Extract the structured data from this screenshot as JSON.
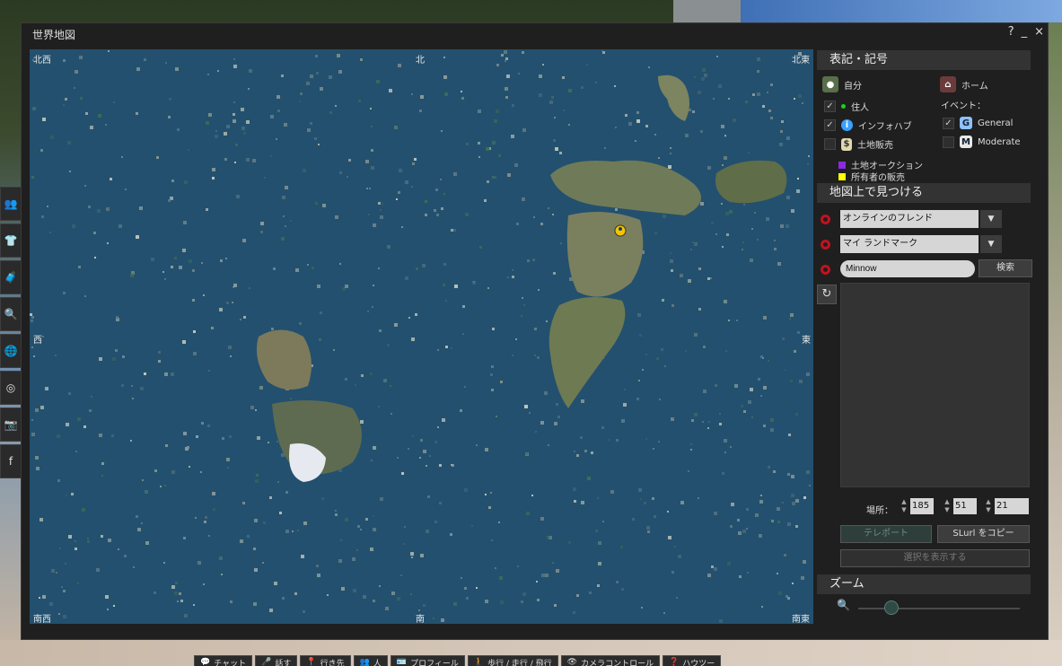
{
  "window": {
    "title": "世界地図",
    "help": "?",
    "minimize": "_",
    "close": "×"
  },
  "compass": {
    "nw": "北西",
    "n": "北",
    "ne": "北東",
    "w": "西",
    "e": "東",
    "sw": "南西",
    "s": "南",
    "se": "南東"
  },
  "legend": {
    "header": "表記・記号",
    "self": "自分",
    "home": "ホーム",
    "resident": "住人",
    "infohub": "インフォハブ",
    "land_sale": "土地販売",
    "events_label": "イベント：",
    "general": "General",
    "moderate": "Moderate",
    "land_auction": "土地オークション",
    "owner_sale": "所有者の販売",
    "resident_checked": true,
    "infohub_checked": true,
    "land_sale_checked": false,
    "general_checked": true,
    "moderate_checked": false
  },
  "find": {
    "header": "地図上で見つける",
    "friends_select": "オンラインのフレンド",
    "landmark_select": "マイ ランドマーク",
    "search_value": "Minnow",
    "search_button": "検索"
  },
  "location": {
    "label": "場所：",
    "x": "185",
    "y": "51",
    "z": "21"
  },
  "actions": {
    "teleport": "テレポート",
    "copy_slurl": "SLurl をコピー",
    "show_selection": "選択を表示する"
  },
  "zoom": {
    "header": "ズーム",
    "level": 0.2
  },
  "bottom_bar": [
    {
      "label": "チャット",
      "icon": "chat-icon"
    },
    {
      "label": "話す",
      "icon": "microphone-icon"
    },
    {
      "label": "行き先",
      "icon": "destination-icon"
    },
    {
      "label": "人",
      "icon": "people-icon"
    },
    {
      "label": "プロフィール",
      "icon": "profile-icon"
    },
    {
      "label": "歩行 / 走行 / 飛行",
      "icon": "walk-icon"
    },
    {
      "label": "カメラコントロール",
      "icon": "camera-icon"
    },
    {
      "label": "ハウツー",
      "icon": "howto-icon"
    }
  ],
  "colors": {
    "water": "#23506e",
    "resident_dot": "#19d119",
    "auction": "#8a2be2",
    "owner_sale": "#ffff00",
    "find_marker": "#c1121f",
    "infohub": "#3aa0ff"
  }
}
